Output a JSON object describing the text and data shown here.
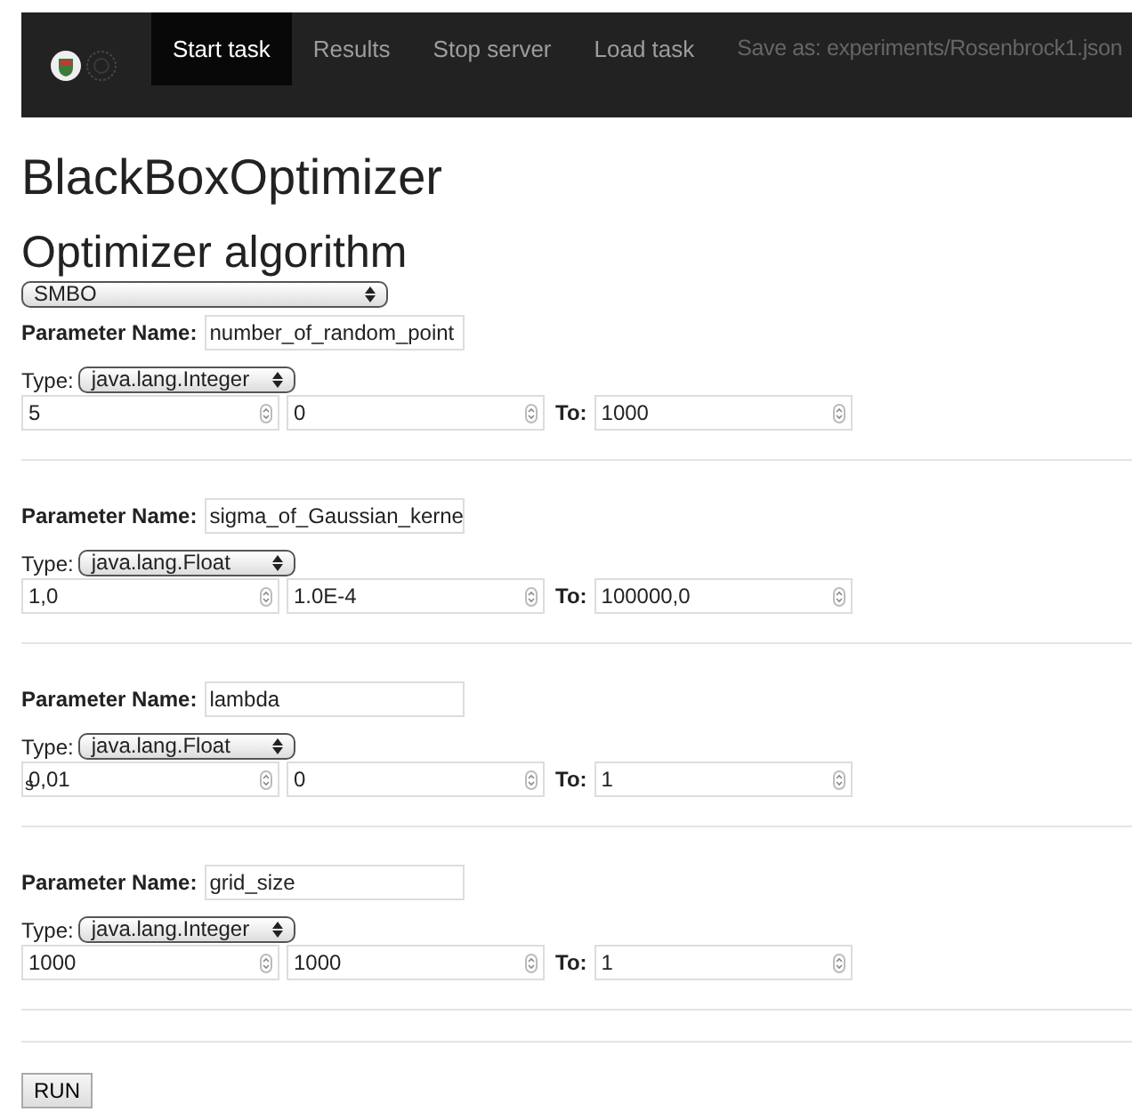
{
  "navbar": {
    "items": [
      {
        "label": "Start task",
        "selected": true,
        "kind": "link"
      },
      {
        "label": "Results",
        "selected": false,
        "kind": "link"
      },
      {
        "label": "Stop server",
        "selected": false,
        "kind": "link"
      },
      {
        "label": "Load task",
        "selected": false,
        "kind": "link"
      },
      {
        "label": "Save as: experiments/Rosenbrock1.json",
        "kind": "text"
      }
    ]
  },
  "title": "BlackBoxOptimizer",
  "section_title": "Optimizer algorithm",
  "algorithm": "SMBO",
  "parameters": [
    {
      "name_label": "Parameter Name:",
      "name": "number_of_random_point",
      "type_label": "Type:",
      "type": "java.lang.Integer",
      "value": "5",
      "from": "0",
      "to_label": "To:",
      "to": "1000"
    },
    {
      "name_label": "Parameter Name:",
      "name": "sigma_of_Gaussian_kerne",
      "type_label": "Type:",
      "type": "java.lang.Float",
      "value": "1,0",
      "from": "1.0E-4",
      "to_label": "To:",
      "to": "100000,0"
    },
    {
      "name_label": "Parameter Name:",
      "name": "lambda",
      "type_label": "Type:",
      "type": "java.lang.Float",
      "value": "0,01",
      "from": "0",
      "to_label": "To:",
      "to": "1",
      "overlay": "s"
    },
    {
      "name_label": "Parameter Name:",
      "name": "grid_size",
      "type_label": "Type:",
      "type": "java.lang.Integer",
      "value": "1000",
      "from": "1000",
      "to_label": "To:",
      "to": "1"
    }
  ],
  "run_button": "RUN"
}
